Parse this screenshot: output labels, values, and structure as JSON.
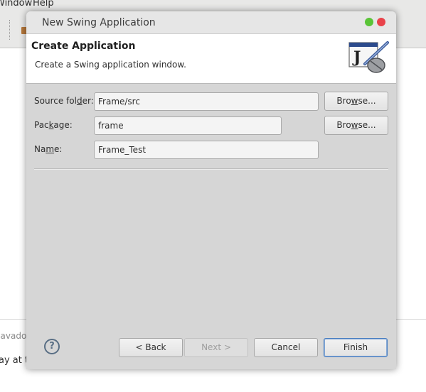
{
  "ide": {
    "menu": [
      "Window",
      "Help"
    ],
    "bottom_tab_label": "Javadoc",
    "console_text": "ay at th"
  },
  "dialog": {
    "title": "New Swing Application",
    "header_title": "Create Application",
    "header_description": "Create a Swing application window.",
    "fields": {
      "source_folder": {
        "label_pre": "Source fol",
        "label_mn": "d",
        "label_post": "er:",
        "value": "Frame/src"
      },
      "package": {
        "label_pre": "Pac",
        "label_mn": "k",
        "label_post": "age:",
        "value": "frame"
      },
      "name": {
        "label_pre": "Na",
        "label_mn": "m",
        "label_post": "e:",
        "value": "Frame_Test"
      }
    },
    "browse_pre": "Bro",
    "browse_mn": "w",
    "browse_post": "se...",
    "buttons": {
      "back": "< Back",
      "next": "Next >",
      "cancel": "Cancel",
      "finish": "Finish"
    },
    "help_glyph": "?"
  },
  "colors": {
    "dialog_bg": "#d6d6d6",
    "header_bg": "#ffffff",
    "default_button_border": "#4a7fc1",
    "close_dot": "#e9424a",
    "maximize_dot": "#5ac437"
  },
  "icons": [
    "java-swing-wizard-icon",
    "help-icon"
  ]
}
